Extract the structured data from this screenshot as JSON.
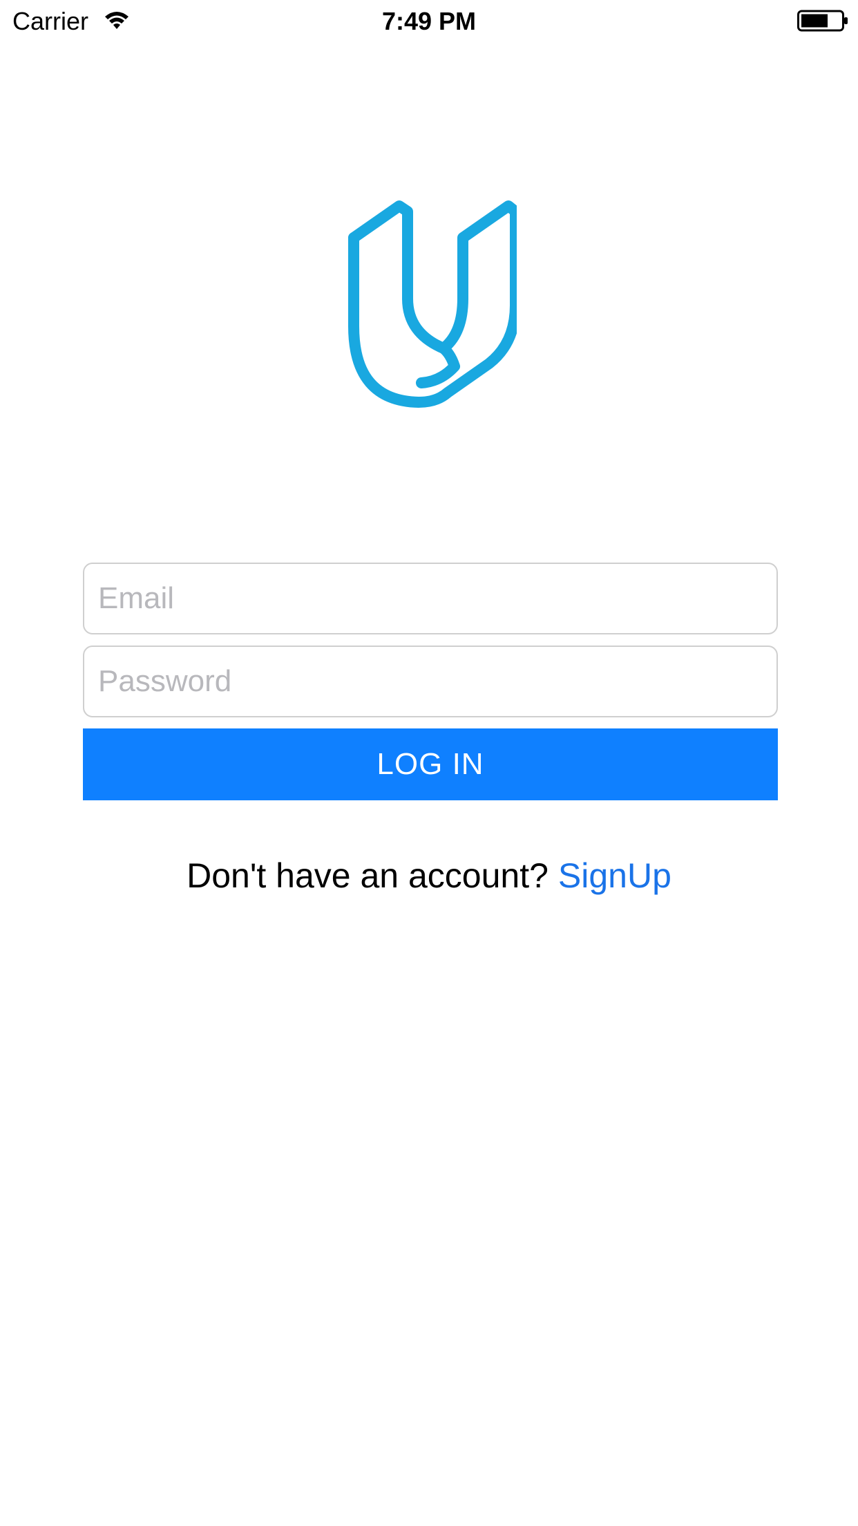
{
  "status_bar": {
    "carrier": "Carrier",
    "time": "7:49 PM",
    "icons": [
      "wifi-icon",
      "battery-icon"
    ]
  },
  "logo": {
    "icon": "udacity-u-logo",
    "color": "#19a8e0"
  },
  "form": {
    "email": {
      "placeholder": "Email",
      "value": ""
    },
    "password": {
      "placeholder": "Password",
      "value": ""
    },
    "login_label": "LOG IN"
  },
  "signup": {
    "prompt": "Don't have an account?",
    "link_label": "SignUp"
  },
  "colors": {
    "primary_button": "#0f80ff",
    "link": "#1a73e8",
    "placeholder": "#b8b8bc",
    "field_border": "#cfcfcf"
  }
}
